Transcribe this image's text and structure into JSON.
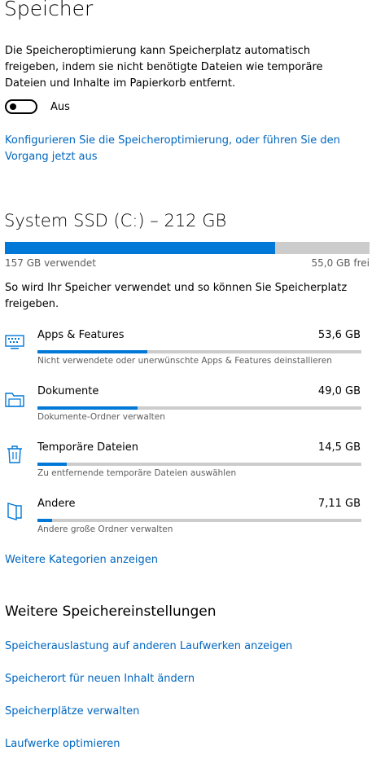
{
  "page": {
    "title": "Speicher"
  },
  "storage_sense": {
    "description": "Die Speicheroptimierung kann Speicherplatz automatisch freigeben, indem sie nicht benötigte Dateien wie temporäre Dateien und Inhalte im Papierkorb entfernt.",
    "toggle_state_label": "Aus",
    "toggle_on": false,
    "configure_link": "Konfigurieren Sie die Speicheroptimierung, oder führen Sie den Vorgang jetzt aus"
  },
  "drive": {
    "title": "System SSD (C:) – 212 GB",
    "used_label": "157 GB verwendet",
    "free_label": "55,0 GB frei",
    "used_fraction": 0.74,
    "usage_intro": "So wird Ihr Speicher verwendet und so können Sie Speicherplatz freigeben."
  },
  "categories": [
    {
      "icon": "keyboard-icon",
      "name": "Apps & Features",
      "size": "53,6 GB",
      "description": "Nicht verwendete oder unerwünschte Apps & Features deinstallieren",
      "fraction": 0.34
    },
    {
      "icon": "folder-icon",
      "name": "Dokumente",
      "size": "49,0 GB",
      "description": "Dokumente-Ordner verwalten",
      "fraction": 0.31
    },
    {
      "icon": "trash-icon",
      "name": "Temporäre Dateien",
      "size": "14,5 GB",
      "description": "Zu entfernende temporäre Dateien auswählen",
      "fraction": 0.09
    },
    {
      "icon": "other-folder-icon",
      "name": "Andere",
      "size": "7,11 GB",
      "description": "Andere große Ordner verwalten",
      "fraction": 0.045
    }
  ],
  "more_categories_link": "Weitere Kategorien anzeigen",
  "more_settings": {
    "title": "Weitere Speichereinstellungen",
    "links": [
      "Speicherauslastung auf anderen Laufwerken anzeigen",
      "Speicherort für neuen Inhalt ändern",
      "Speicherplätze verwalten",
      "Laufwerke optimieren"
    ]
  },
  "colors": {
    "accent": "#0078d7",
    "link": "#0067c0",
    "bar_track": "#cccccc"
  }
}
